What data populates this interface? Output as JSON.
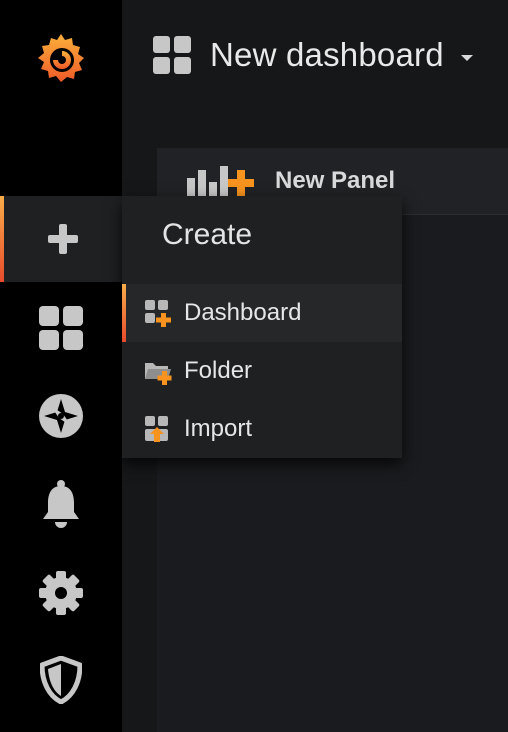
{
  "header": {
    "dashboard_title": "New dashboard"
  },
  "panel": {
    "new_panel_label": "New Panel"
  },
  "create_menu": {
    "title": "Create",
    "items": [
      {
        "label": "Dashboard",
        "icon": "dashboard-add-icon"
      },
      {
        "label": "Folder",
        "icon": "folder-add-icon"
      },
      {
        "label": "Import",
        "icon": "import-icon"
      }
    ]
  },
  "sidebar": {
    "items": [
      {
        "icon": "grafana-logo"
      },
      {
        "icon": "plus-icon"
      },
      {
        "icon": "dashboards-icon"
      },
      {
        "icon": "compass-icon"
      },
      {
        "icon": "bell-icon"
      },
      {
        "icon": "gear-icon"
      },
      {
        "icon": "shield-icon"
      }
    ]
  },
  "colors": {
    "accent_orange": "#f7931e",
    "accent_red": "#e74a2b",
    "sidebar_bg": "#000000",
    "icon_gray": "#c7c7c7"
  }
}
